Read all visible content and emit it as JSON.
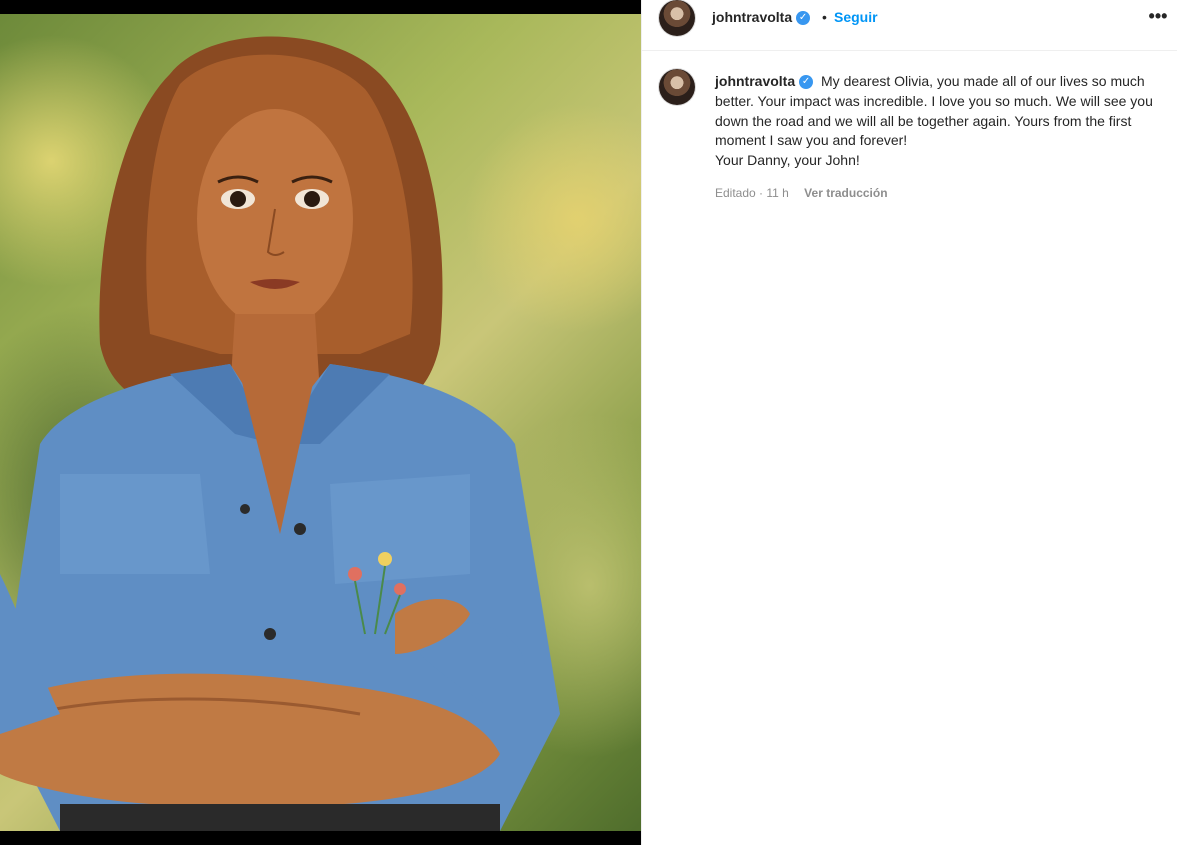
{
  "post": {
    "image_alt": "photo of a woman in a denim shirt with arms crossed",
    "author": {
      "username": "johntravolta",
      "verified_icon": "verified-badge-icon",
      "follow_label": "Seguir",
      "separator": "•"
    },
    "more_icon": "more-options-icon",
    "more_label": "•••",
    "caption": {
      "username": "johntravolta",
      "text": "My dearest Olivia, you made all of our lives so much better. Your impact was incredible. I love you so much. We will see you down the road and we will all be together again. Yours from the first moment I saw you and forever!\nYour Danny, your John!"
    },
    "meta": {
      "edited": "Editado · 11 h",
      "translate_label": "Ver traducción"
    }
  },
  "colors": {
    "link_blue": "#0095f6",
    "verified_blue": "#3897f0",
    "muted_text": "#8e8e8e"
  }
}
